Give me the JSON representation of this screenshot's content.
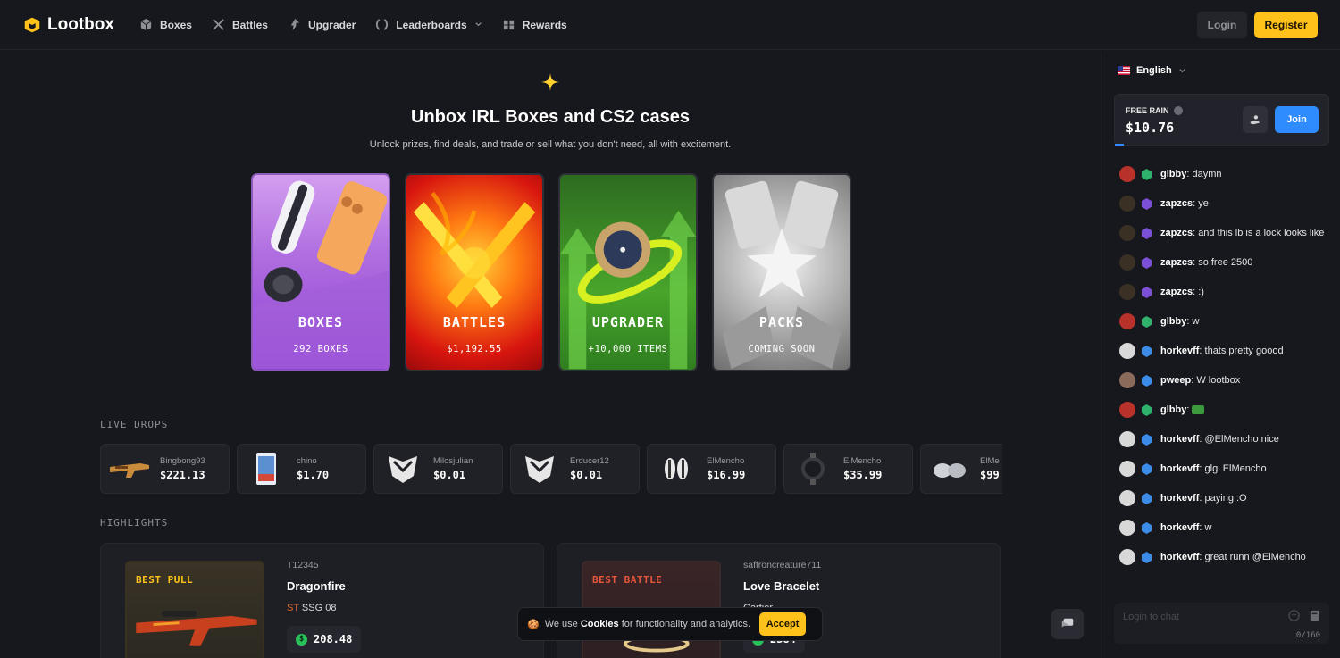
{
  "header": {
    "brand": "Lootbox",
    "nav": [
      {
        "label": "Boxes",
        "icon": "cube-icon"
      },
      {
        "label": "Battles",
        "icon": "crossed-swords-icon"
      },
      {
        "label": "Upgrader",
        "icon": "upgrade-arrow-icon"
      },
      {
        "label": "Leaderboards",
        "icon": "laurel-icon"
      },
      {
        "label": "Rewards",
        "icon": "gift-icon"
      }
    ],
    "login_label": "Login",
    "register_label": "Register"
  },
  "hero": {
    "title": "Unbox IRL Boxes and CS2 cases",
    "subtitle": "Unlock prizes, find deals, and trade or sell what you don't need, all with excitement."
  },
  "modes": [
    {
      "title": "BOXES",
      "sub": "292 BOXES"
    },
    {
      "title": "BATTLES",
      "sub": "$1,192.55"
    },
    {
      "title": "UPGRADER",
      "sub": "+10,000 ITEMS"
    },
    {
      "title": "PACKS",
      "sub": "COMING SOON"
    }
  ],
  "live_drops": {
    "label": "LIVE DROPS",
    "items": [
      {
        "user": "Bingbong93",
        "price": "$221.13"
      },
      {
        "user": "chino",
        "price": "$1.70"
      },
      {
        "user": "Milosjulian",
        "price": "$0.01"
      },
      {
        "user": "Erducer12",
        "price": "$0.01"
      },
      {
        "user": "ElMencho",
        "price": "$16.99"
      },
      {
        "user": "ElMencho",
        "price": "$35.99"
      },
      {
        "user": "ElMe",
        "price": "$99"
      }
    ]
  },
  "highlights": {
    "label": "HIGHLIGHTS",
    "items": [
      {
        "tag": "BEST PULL",
        "user": "T12345",
        "item": "Dragonfire",
        "meta_prefix": "ST",
        "meta": "SSG 08",
        "price": "208.48"
      },
      {
        "tag": "BEST BATTLE",
        "user": "saffroncreature711",
        "item": "Love Bracelet",
        "meta": "Cartier",
        "price": "2384"
      }
    ]
  },
  "cookie": {
    "pre": "We use",
    "strong": "Cookies",
    "post": "for functionality and analytics.",
    "accept": "Accept"
  },
  "sidebar": {
    "language": "English",
    "rain": {
      "label": "FREE RAIN",
      "amount": "$10.76",
      "join": "Join"
    },
    "chat": [
      {
        "user": "glbby",
        "text": ": daymn",
        "avatar": "#b8322b",
        "badge": "#2fb36a"
      },
      {
        "user": "zapzcs",
        "text": ": ye",
        "avatar": "#3a3024",
        "badge": "#7b4fd6"
      },
      {
        "user": "zapzcs",
        "text": ": and this lb is a lock looks like",
        "avatar": "#3a3024",
        "badge": "#7b4fd6"
      },
      {
        "user": "zapzcs",
        "text": ": so free 2500",
        "avatar": "#3a3024",
        "badge": "#7b4fd6"
      },
      {
        "user": "zapzcs",
        "text": ": :)",
        "avatar": "#3a3024",
        "badge": "#7b4fd6"
      },
      {
        "user": "glbby",
        "text": ": w",
        "avatar": "#b8322b",
        "badge": "#2fb36a"
      },
      {
        "user": "horkevff",
        "text": ": thats pretty goood",
        "avatar": "#d8d8d8",
        "badge": "#3b8be8"
      },
      {
        "user": "pweep",
        "text": ": W lootbox",
        "avatar": "#8a6a5a",
        "badge": "#3b8be8"
      },
      {
        "user": "glbby",
        "text": ": ",
        "avatar": "#b8322b",
        "badge": "#2fb36a"
      },
      {
        "user": "horkevff",
        "text": ": @ElMencho nice",
        "avatar": "#d8d8d8",
        "badge": "#3b8be8"
      },
      {
        "user": "horkevff",
        "text": ": glgl ElMencho",
        "avatar": "#d8d8d8",
        "badge": "#3b8be8"
      },
      {
        "user": "horkevff",
        "text": ": paying :O",
        "avatar": "#d8d8d8",
        "badge": "#3b8be8"
      },
      {
        "user": "horkevff",
        "text": ": w",
        "avatar": "#d8d8d8",
        "badge": "#3b8be8"
      },
      {
        "user": "horkevff",
        "text": ": great runn @ElMencho",
        "avatar": "#d8d8d8",
        "badge": "#3b8be8"
      }
    ],
    "chat_placeholder": "Login to chat",
    "char_count": "0/160"
  },
  "colors": {
    "accent": "#ffc21a",
    "join": "#2e8cff",
    "background": "#17181d"
  }
}
